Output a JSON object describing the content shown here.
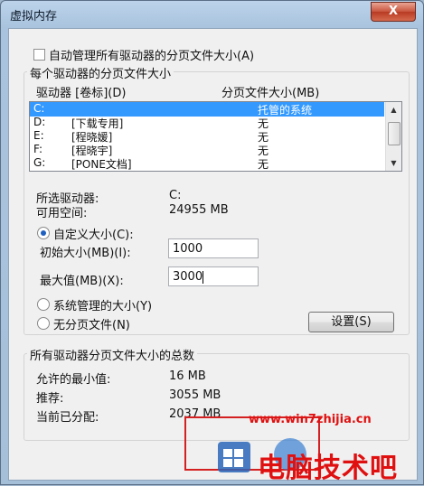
{
  "window": {
    "title": "虚拟内存",
    "close_label": "X"
  },
  "auto_manage": {
    "label": "自动管理所有驱动器的分页文件大小(A)",
    "checked": false
  },
  "per_drive": {
    "group_label": "每个驱动器的分页文件大小",
    "col_drive": "驱动器 [卷标](D)",
    "col_size": "分页文件大小(MB)",
    "drives": [
      {
        "drive": "C:",
        "label": "",
        "size": "托管的系统"
      },
      {
        "drive": "D:",
        "label": "[下载专用]",
        "size": "无"
      },
      {
        "drive": "E:",
        "label": "[程晓媛]",
        "size": "无"
      },
      {
        "drive": "F:",
        "label": "[程晓宇]",
        "size": "无"
      },
      {
        "drive": "G:",
        "label": "[PONE文档]",
        "size": "无"
      }
    ],
    "selected_drive_label": "所选驱动器:",
    "selected_drive_value": "C:",
    "free_space_label": "可用空间:",
    "free_space_value": "24955 MB",
    "custom_size_label": "自定义大小(C):",
    "initial_size_label": "初始大小(MB)(I):",
    "initial_size_value": "1000",
    "max_size_label": "最大值(MB)(X):",
    "max_size_value": "3000",
    "system_managed_label": "系统管理的大小(Y)",
    "no_paging_label": "无分页文件(N)",
    "set_button": "设置(S)"
  },
  "total": {
    "group_label": "所有驱动器分页文件大小的总数",
    "min_label": "允许的最小值:",
    "min_value": "16 MB",
    "recommended_label": "推荐:",
    "recommended_value": "3055 MB",
    "allocated_label": "当前已分配:",
    "allocated_value": "2037 MB"
  },
  "watermark": {
    "url": "www.win7zhijia.cn",
    "text": "电脑技术吧"
  }
}
